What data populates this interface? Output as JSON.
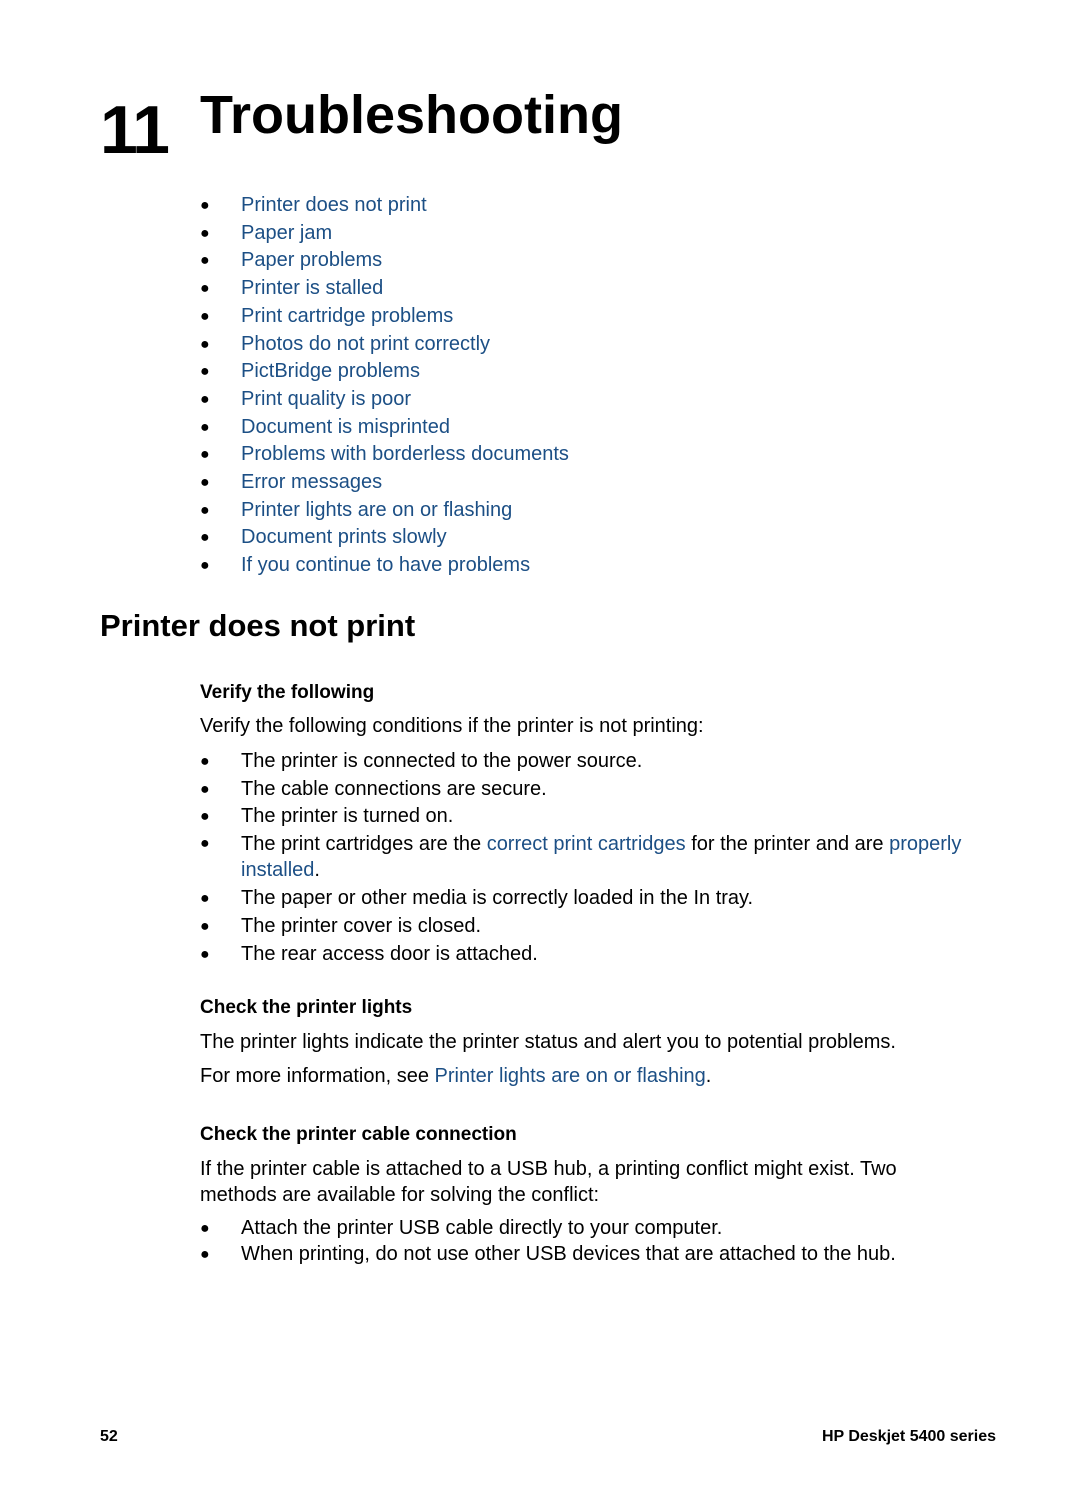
{
  "chapter": {
    "number": "11",
    "title": "Troubleshooting"
  },
  "toc": [
    "Printer does not print",
    "Paper jam",
    "Paper problems",
    "Printer is stalled",
    "Print cartridge problems",
    "Photos do not print correctly",
    "PictBridge problems",
    "Print quality is poor",
    "Document is misprinted",
    "Problems with borderless documents",
    "Error messages",
    "Printer lights are on or flashing",
    "Document prints slowly",
    "If you continue to have problems"
  ],
  "section": {
    "title": "Printer does not print",
    "verify": {
      "heading": "Verify the following",
      "intro": "Verify the following conditions if the printer is not printing:",
      "items": [
        "The printer is connected to the power source.",
        "The cable connections are secure.",
        "The printer is turned on.",
        {
          "pre": "The print cartridges are the ",
          "link1": "correct print cartridges",
          "mid": " for the printer and are ",
          "link2": "properly installed",
          "post": "."
        },
        "The paper or other media is correctly loaded in the In tray.",
        "The printer cover is closed.",
        "The rear access door is attached."
      ]
    },
    "lights": {
      "heading": "Check the printer lights",
      "text": "The printer lights indicate the printer status and alert you to potential problems.",
      "more_pre": "For more information, see ",
      "more_link": "Printer lights are on or flashing",
      "more_post": "."
    },
    "cable": {
      "heading": "Check the printer cable connection",
      "text": "If the printer cable is attached to a USB hub, a printing conflict might exist. Two methods are available for solving the conflict:",
      "items": [
        "Attach the printer USB cable directly to your computer.",
        "When printing, do not use other USB devices that are attached to the hub."
      ]
    }
  },
  "footer": {
    "page_number": "52",
    "product": "HP Deskjet 5400 series"
  },
  "bullet_glyph": "●",
  "colors": {
    "link": "#1c4f85",
    "text": "#000000"
  }
}
